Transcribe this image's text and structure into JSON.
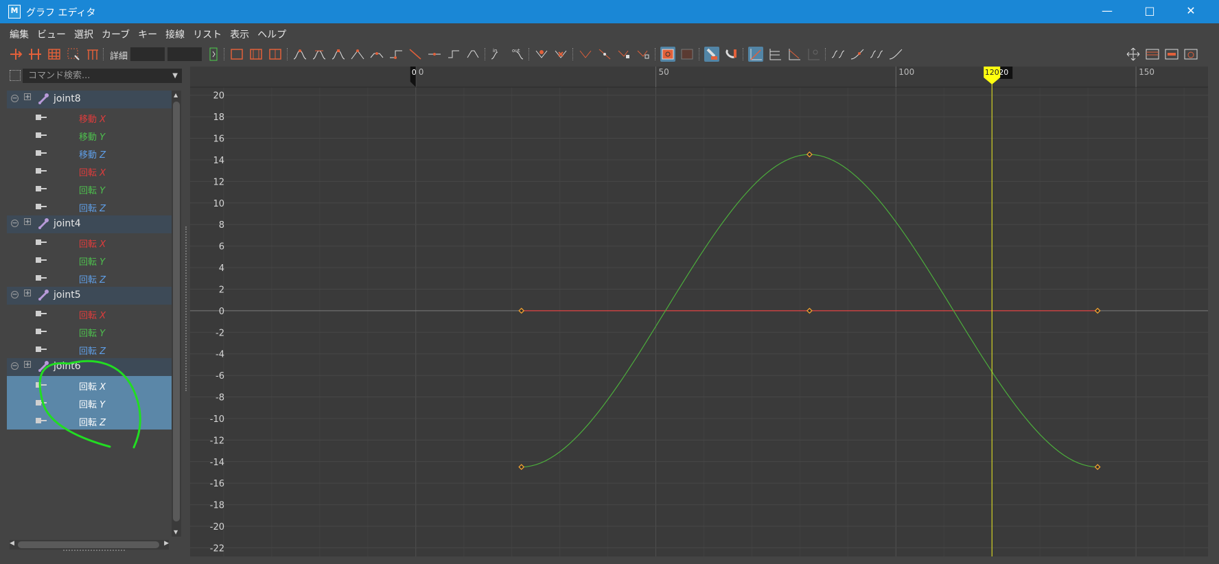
{
  "window": {
    "app_icon": "M",
    "title": "グラフ エディタ",
    "minimize": "—",
    "maximize": "□",
    "close": "✕"
  },
  "menu": [
    "編集",
    "ビュー",
    "選択",
    "カーブ",
    "キー",
    "接線",
    "リスト",
    "表示",
    "ヘルプ"
  ],
  "toolbar": {
    "detail_label": "詳細",
    "detail_value": "",
    "detail_value2": ""
  },
  "search": {
    "placeholder": "コマンド検索..."
  },
  "outliner": [
    {
      "type": "joint",
      "name": "joint8"
    },
    {
      "type": "channel",
      "label": "移動",
      "axis": "X",
      "color": "#e03c3c"
    },
    {
      "type": "channel",
      "label": "移動",
      "axis": "Y",
      "color": "#4ec04e"
    },
    {
      "type": "channel",
      "label": "移動",
      "axis": "Z",
      "color": "#5f9ee6"
    },
    {
      "type": "channel",
      "label": "回転",
      "axis": "X",
      "color": "#e03c3c"
    },
    {
      "type": "channel",
      "label": "回転",
      "axis": "Y",
      "color": "#4ec04e"
    },
    {
      "type": "channel",
      "label": "回転",
      "axis": "Z",
      "color": "#5f9ee6"
    },
    {
      "type": "joint",
      "name": "joint4"
    },
    {
      "type": "channel",
      "label": "回転",
      "axis": "X",
      "color": "#e03c3c"
    },
    {
      "type": "channel",
      "label": "回転",
      "axis": "Y",
      "color": "#4ec04e"
    },
    {
      "type": "channel",
      "label": "回転",
      "axis": "Z",
      "color": "#5f9ee6"
    },
    {
      "type": "joint",
      "name": "joint5"
    },
    {
      "type": "channel",
      "label": "回転",
      "axis": "X",
      "color": "#e03c3c"
    },
    {
      "type": "channel",
      "label": "回転",
      "axis": "Y",
      "color": "#4ec04e"
    },
    {
      "type": "channel",
      "label": "回転",
      "axis": "Z",
      "color": "#5f9ee6"
    },
    {
      "type": "joint",
      "name": "joint6"
    },
    {
      "type": "channel",
      "label": "回転",
      "axis": "X",
      "color": "#ffffff",
      "selected": true
    },
    {
      "type": "channel",
      "label": "回転",
      "axis": "Y",
      "color": "#ffffff",
      "selected": true
    },
    {
      "type": "channel",
      "label": "回転",
      "axis": "Z",
      "color": "#ffffff",
      "selected": true
    }
  ],
  "graph": {
    "x_ticks": [
      "0",
      "50",
      "100",
      "150"
    ],
    "x_tick_values": [
      0,
      50,
      100,
      150
    ],
    "x_range": [
      -47,
      165
    ],
    "y_range": [
      -22.8,
      21
    ],
    "y_ticks": [
      "20",
      "18",
      "16",
      "14",
      "12",
      "10",
      "8",
      "6",
      "4",
      "2",
      "0",
      "-2",
      "-4",
      "-6",
      "-8",
      "-10",
      "-12",
      "-14",
      "-16",
      "-18",
      "-20",
      "-22"
    ],
    "y_tick_values": [
      20,
      18,
      16,
      14,
      12,
      10,
      8,
      6,
      4,
      2,
      0,
      -2,
      -4,
      -6,
      -8,
      -10,
      -12,
      -14,
      -16,
      -18,
      -20,
      -22
    ],
    "current_frame": "120",
    "current_frame_value": 120,
    "start_frame_marker": "0",
    "end_marker_label": "20",
    "curves": [
      {
        "name": "回転 X",
        "color": "#e04040",
        "keys": [
          [
            22,
            0
          ],
          [
            82,
            0
          ],
          [
            142,
            0
          ]
        ]
      },
      {
        "name": "回転 Y",
        "color": "#4cae3c",
        "keys": [
          [
            22,
            -14.5
          ],
          [
            82,
            14.5
          ],
          [
            142,
            -14.5
          ]
        ]
      }
    ],
    "key_color": "#f0a030",
    "timeline_color": "#f0f020",
    "background": "#3a3a3a"
  }
}
